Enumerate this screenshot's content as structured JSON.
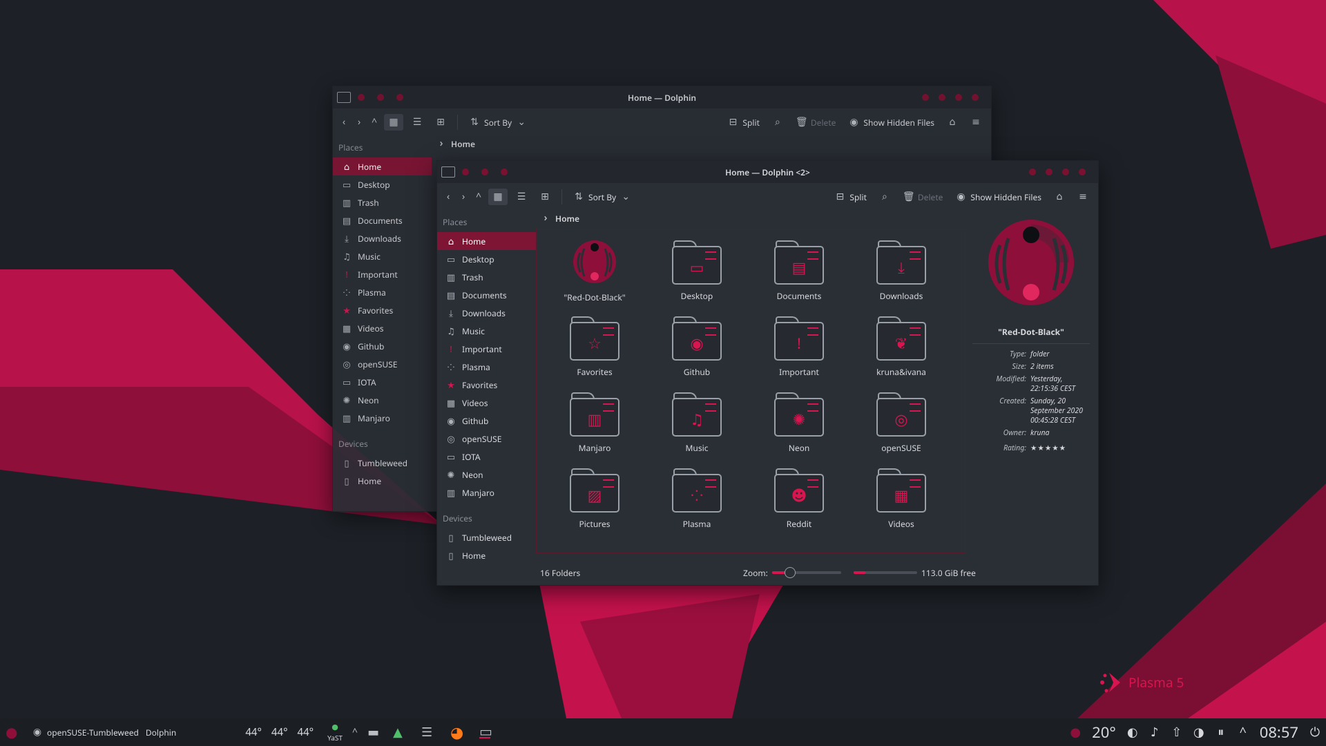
{
  "colors": {
    "accent": "#d8154f",
    "accent_dark": "#7f1535",
    "bg": "#1d2127",
    "window": "#2a2e35"
  },
  "desktop": {
    "plasma_label": "Plasma 5"
  },
  "back_window": {
    "title": "Home — Dolphin",
    "sort_label": "Sort By",
    "split_label": "Split",
    "delete_label": "Delete",
    "hidden_label": "Show Hidden Files",
    "breadcrumb": "Home",
    "places_header": "Places",
    "places": [
      {
        "label": "Home",
        "icon": "home-icon"
      },
      {
        "label": "Desktop",
        "icon": "desktop-icon"
      },
      {
        "label": "Trash",
        "icon": "trash-icon"
      },
      {
        "label": "Documents",
        "icon": "documents-icon"
      },
      {
        "label": "Downloads",
        "icon": "downloads-icon"
      },
      {
        "label": "Music",
        "icon": "music-icon"
      },
      {
        "label": "Important",
        "icon": "important-icon"
      },
      {
        "label": "Plasma",
        "icon": "plasma-icon"
      },
      {
        "label": "Favorites",
        "icon": "star-icon"
      },
      {
        "label": "Videos",
        "icon": "videos-icon"
      },
      {
        "label": "Github",
        "icon": "github-icon"
      },
      {
        "label": "openSUSE",
        "icon": "opensuse-icon"
      },
      {
        "label": "IOTA",
        "icon": "folder-icon"
      },
      {
        "label": "Neon",
        "icon": "neon-icon"
      },
      {
        "label": "Manjaro",
        "icon": "manjaro-icon"
      }
    ],
    "devices_header": "Devices",
    "devices": [
      {
        "label": "Tumbleweed"
      },
      {
        "label": "Home"
      }
    ]
  },
  "window": {
    "title": "Home — Dolphin <2>",
    "sort_label": "Sort By",
    "split_label": "Split",
    "delete_label": "Delete",
    "hidden_label": "Show Hidden Files",
    "breadcrumb": "Home",
    "places_header": "Places",
    "places": [
      {
        "label": "Home",
        "icon": "home-icon"
      },
      {
        "label": "Desktop",
        "icon": "desktop-icon"
      },
      {
        "label": "Trash",
        "icon": "trash-icon"
      },
      {
        "label": "Documents",
        "icon": "documents-icon"
      },
      {
        "label": "Downloads",
        "icon": "downloads-icon"
      },
      {
        "label": "Music",
        "icon": "music-icon"
      },
      {
        "label": "Important",
        "icon": "important-icon"
      },
      {
        "label": "Plasma",
        "icon": "plasma-icon"
      },
      {
        "label": "Favorites",
        "icon": "star-icon"
      },
      {
        "label": "Videos",
        "icon": "videos-icon"
      },
      {
        "label": "Github",
        "icon": "github-icon"
      },
      {
        "label": "openSUSE",
        "icon": "opensuse-icon"
      },
      {
        "label": "IOTA",
        "icon": "folder-icon"
      },
      {
        "label": "Neon",
        "icon": "neon-icon"
      },
      {
        "label": "Manjaro",
        "icon": "manjaro-icon"
      }
    ],
    "devices_header": "Devices",
    "devices": [
      {
        "label": "Tumbleweed"
      },
      {
        "label": "Home"
      }
    ],
    "files": [
      {
        "label": "\"Red-Dot-Black\"",
        "emblem": "avatar"
      },
      {
        "label": "Desktop",
        "emblem": "▭"
      },
      {
        "label": "Documents",
        "emblem": "▤"
      },
      {
        "label": "Downloads",
        "emblem": "⤓"
      },
      {
        "label": "Favorites",
        "emblem": "☆"
      },
      {
        "label": "Github",
        "emblem": "◉"
      },
      {
        "label": "Important",
        "emblem": "!"
      },
      {
        "label": "kruna&ivana",
        "emblem": "❦"
      },
      {
        "label": "Manjaro",
        "emblem": "▥"
      },
      {
        "label": "Music",
        "emblem": "♫"
      },
      {
        "label": "Neon",
        "emblem": "✺"
      },
      {
        "label": "openSUSE",
        "emblem": "◎"
      },
      {
        "label": "Pictures",
        "emblem": "▨"
      },
      {
        "label": "Plasma",
        "emblem": "⁘"
      },
      {
        "label": "Reddit",
        "emblem": "☻"
      },
      {
        "label": "Videos",
        "emblem": "▦"
      }
    ],
    "preview": {
      "name": "\"Red-Dot-Black\"",
      "meta": [
        {
          "k": "Type:",
          "v": "folder"
        },
        {
          "k": "Size:",
          "v": "2 items"
        },
        {
          "k": "Modified:",
          "v": "Yesterday, 22:15:36 CEST"
        },
        {
          "k": "Created:",
          "v": "Sunday, 20 September 2020 00:45:28 CEST"
        },
        {
          "k": "Owner:",
          "v": "kruna"
        }
      ],
      "rating_label": "Rating:",
      "rating": 0
    },
    "status": {
      "folders": "16 Folders",
      "zoom_label": "Zoom:",
      "zoom_level": 0.25,
      "free_text": "113.0 GiB free",
      "used_fraction": 0.18
    }
  },
  "taskbar": {
    "tasks": [
      {
        "label": "openSUSE-Tumbleweed"
      },
      {
        "label": "Dolphin"
      }
    ],
    "temps": [
      "44°",
      "44°",
      "44°"
    ],
    "yast": "YaST",
    "weather": "20°",
    "clock": "08:57"
  }
}
